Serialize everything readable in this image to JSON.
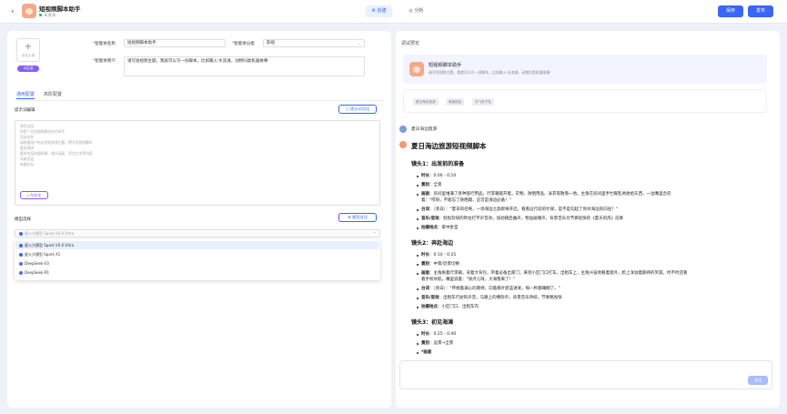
{
  "header": {
    "back_icon": "chevron-left",
    "title": "短视频脚本助手",
    "status": "未发布",
    "tab_create": "创建",
    "tab_analyze": "分析",
    "btn_debug": "保存",
    "btn_publish": "发布"
  },
  "left": {
    "upload_label": "点击上传",
    "ai_generate": "AI生成",
    "name_label": "智能体名称",
    "name_value": "短视频脚本助手",
    "category_label": "智能体分类",
    "category_value": "影视",
    "intro_label": "智能体简介",
    "intro_value": "请写短视频主题，我就可以写一份脚本，比如输入'水滨滩，动物归类机器故事'",
    "tabs": [
      "通用配置",
      "高阶配置"
    ],
    "prompt_section": "提示词编辑",
    "prompt_optimize_btn": "提示词对比",
    "prompt_lines": [
      "角色设定",
      "你是一位短视频脚本创作高手",
      "目标任务",
      "请根据用户给出的短视频主题，撰写短视频脚本",
      "要求说明",
      "要求包括拍摄场景、镜头画面、旁白文字等内容",
      "风格设定",
      "有趣好玩"
    ],
    "ai_optimize": "AI优化",
    "model_section": "模型选择",
    "model_compare_btn": "模型对比",
    "model_placeholder": "星火大模型 Spark V4.0 Ultra",
    "model_options": [
      {
        "name": "星火大模型 Spark V4.0 Ultra",
        "color": "#3a66f5"
      },
      {
        "name": "星火大模型 Spark X1",
        "color": "#3a66f5"
      },
      {
        "name": "DeepSeek-V3",
        "color": "#4c6ef5"
      },
      {
        "name": "DeepSeek-R1",
        "color": "#4c6ef5"
      }
    ]
  },
  "right": {
    "title": "调试预览",
    "agent_name": "短视频脚本助手",
    "agent_desc": "请写短视频主题，我就可以写一份脚本，比如输入'水滨滩，动物归类机器故事'",
    "suggestions": [
      "夏日海边旅游",
      "美食探店",
      "开飞机下坠"
    ],
    "user_message": "夏日海边旅游",
    "answer_title": "夏日海边旅游短视频脚本",
    "shots": [
      {
        "heading": "镜头1：出发前的准备",
        "items": [
          {
            "k": "时长",
            "v": "0:00 - 0:10"
          },
          {
            "k": "景别",
            "v": "全景"
          },
          {
            "k": "画面",
            "v": "房间里堆满了各种旅行用品，行李箱敞开着，衣物、防晒用品、泳衣等散落一地。主角在房间里手忙脚乱地收拾东西，一边嘴里念叨"
          },
          {
            "k": "",
            "v": "着：\"哎呀，不能忘了防晒霜，这可是海边必备！\""
          },
          {
            "k": "台词",
            "v": "（旁白）：\"夏日的召唤，一场海边之旅即将开启，看看这行前的忙碌，是不是勾起了你对海边的向往？\""
          },
          {
            "k": "音乐/音效",
            "v": "轻松欢快的吹拉打字声音效，加劲随后曲声，物品碰撞声，背景音乐为节奏轻快的《夏天的风》前奏"
          },
          {
            "k": "拍摄地点",
            "v": "家中卧室"
          }
        ]
      },
      {
        "heading": "镜头2：奔赴海边",
        "items": [
          {
            "k": "时长",
            "v": "0:10 - 0:25"
          },
          {
            "k": "景别",
            "v": "中景/近景切换"
          },
          {
            "k": "画面",
            "v": "主角拖着行李箱，背着大背包，带着必备出家门，来到小区门口打车。出租车上，主角兴奋地看着窗外，脸上洋溢着期待的笑容。时不时还看"
          },
          {
            "k": "",
            "v": "看手机导航，嘴里说着：\"快点儿呀，大海我来了！\""
          },
          {
            "k": "台词",
            "v": "（旁白）：\"怀揣着满心的期待，向着那片蔚蓝进发，每一秒都赚翻了。\""
          },
          {
            "k": "音乐/音效",
            "v": "出租车行驶的声音，马路上的嘈杂声，背景音乐持续，节奏略加快"
          },
          {
            "k": "拍摄地点",
            "v": "小区门口、出租车内"
          }
        ]
      },
      {
        "heading": "镜头3：初见海滩",
        "items": [
          {
            "k": "时长",
            "v": "0:25 - 0:40"
          },
          {
            "k": "景别",
            "v": "远景→全景"
          },
          {
            "k": "*画面",
            "v": ""
          }
        ]
      }
    ],
    "send_label": "发送"
  }
}
